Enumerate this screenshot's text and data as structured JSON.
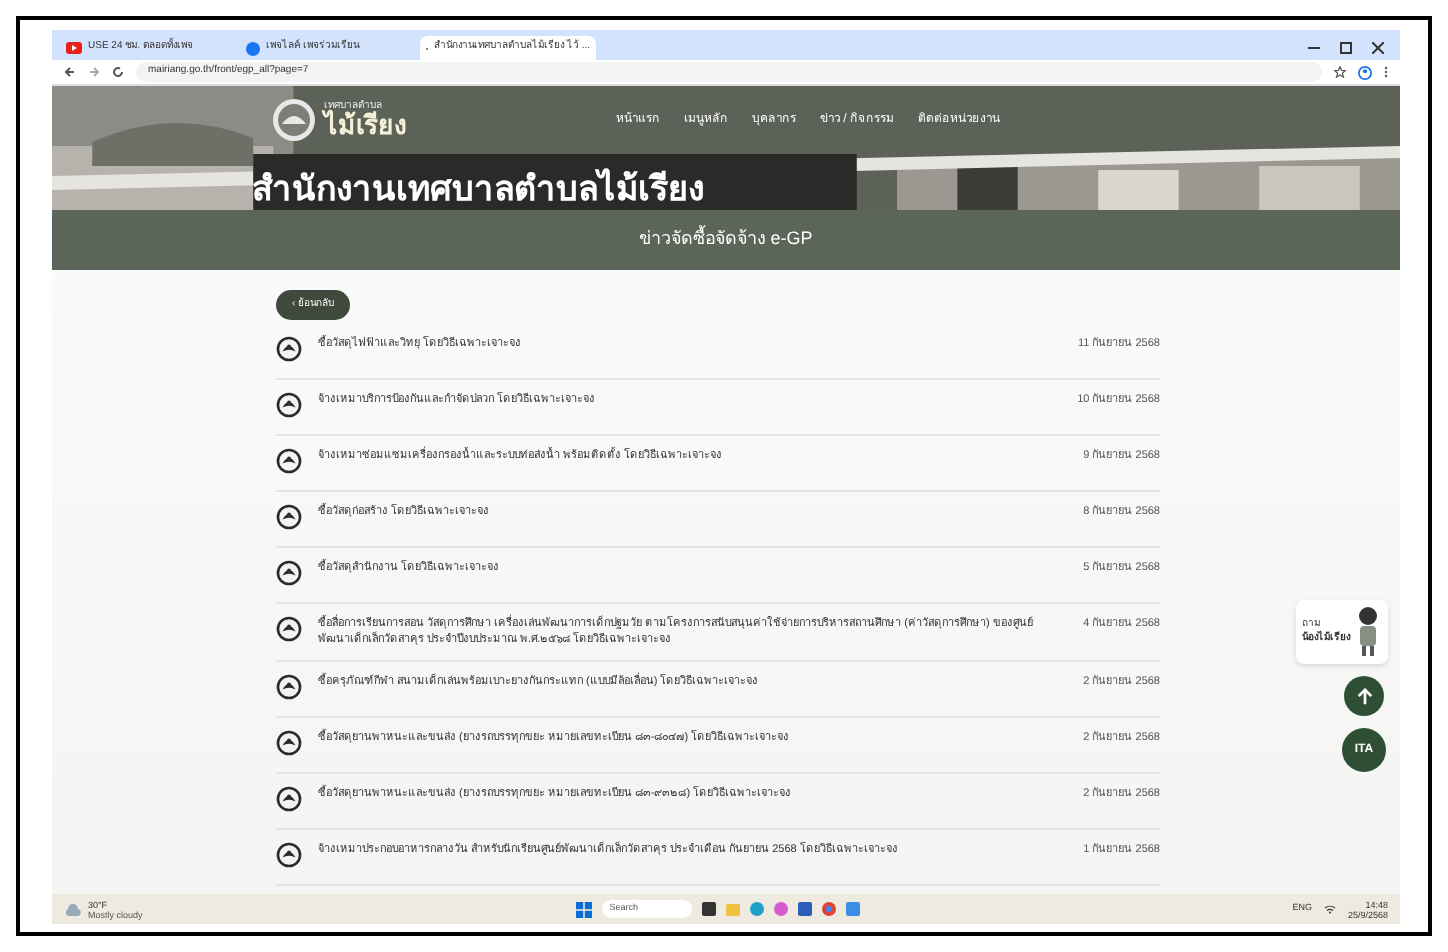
{
  "browser": {
    "tabs": [
      {
        "title": "USE 24 ชม. ตลอดทั้งเพจ",
        "selected": false,
        "kind": "video"
      },
      {
        "title": "เพจไลค์ เพจร่วมเรียน",
        "selected": false,
        "kind": "social"
      },
      {
        "title": "สำนักงานเทศบาลตำบลไม้เรียง ไว้ ...",
        "selected": true,
        "kind": "site"
      }
    ],
    "url": "mairiang.go.th/front/egp_all?page=7"
  },
  "site": {
    "logo_caption": "เทศบาลตำบล",
    "logo_name": "ไม้เรียง",
    "banner_text": "สำนักงานเทศบาลตำบลไม้เรียง",
    "nav": [
      "หน้าแรก",
      "เมนูหลัก",
      "บุคลากร",
      "ข่าว / กิจกรรม",
      "ติดต่อหน่วยงาน"
    ],
    "page_title": "ข่าวจัดซื้อจัดจ้าง e-GP",
    "back_label": "‹ ย้อนกลับ",
    "items": [
      {
        "title": "ซื้อวัสดุไฟฟ้าและวิทยุ โดยวิธีเฉพาะเจาะจง",
        "date": "11 กันยายน 2568"
      },
      {
        "title": "จ้างเหมาบริการป้องกันและกำจัดปลวก โดยวิธีเฉพาะเจาะจง",
        "date": "10 กันยายน 2568"
      },
      {
        "title": "จ้างเหมาซ่อมแซมเครื่องกรองน้ำและระบบท่อส่งน้ำ พร้อมติดตั้ง โดยวิธีเฉพาะเจาะจง",
        "date": "9 กันยายน 2568"
      },
      {
        "title": "ซื้อวัสดุก่อสร้าง โดยวิธีเฉพาะเจาะจง",
        "date": "8 กันยายน 2568"
      },
      {
        "title": "ซื้อวัสดุสำนักงาน โดยวิธีเฉพาะเจาะจง",
        "date": "5 กันยายน 2568"
      },
      {
        "title": "ซื้อสื่อการเรียนการสอน วัสดุการศึกษา เครื่องเล่นพัฒนาการเด็กปฐมวัย ตามโครงการสนับสนุนค่าใช้จ่ายการบริหารสถานศึกษา (ค่าวัสดุการศึกษา) ของศูนย์พัฒนาเด็กเล็กวัดสาคุร ประจำปีงบประมาณ พ.ศ.๒๕๖๘ โดยวิธีเฉพาะเจาะจง",
        "date": "4 กันยายน 2568"
      },
      {
        "title": "ซื้อครุภัณฑ์กีฬา สนามเด็กเล่นพร้อมเบาะยางกันกระแทก (แบบมีล้อเลื่อน) โดยวิธีเฉพาะเจาะจง",
        "date": "2 กันยายน 2568"
      },
      {
        "title": "ซื้อวัสดุยานพาหนะและขนส่ง (ยางรถบรรทุกขยะ หมายเลขทะเบียน ๘๓-๘๐๔๗) โดยวิธีเฉพาะเจาะจง",
        "date": "2 กันยายน 2568"
      },
      {
        "title": "ซื้อวัสดุยานพาหนะและขนส่ง (ยางรถบรรทุกขยะ หมายเลขทะเบียน ๘๓-๙๓๒๘) โดยวิธีเฉพาะเจาะจง",
        "date": "2 กันยายน 2568"
      },
      {
        "title": "จ้างเหมาประกอบอาหารกลางวัน สำหรับนักเรียนศูนย์พัฒนาเด็กเล็กวัดสาคุร ประจำเดือน กันยายน 2568 โดยวิธีเฉพาะเจาะจง",
        "date": "1 กันยายน 2568"
      }
    ],
    "chat_widget": {
      "ask": "ถาม",
      "name": "น้องไม้เรียง"
    },
    "ita_badge": "ITA"
  },
  "taskbar": {
    "temperature": "30°F",
    "weather": "Mostly cloudy",
    "search": "Search",
    "language": "ENG",
    "time": "14:48",
    "date": "25/9/2568"
  }
}
